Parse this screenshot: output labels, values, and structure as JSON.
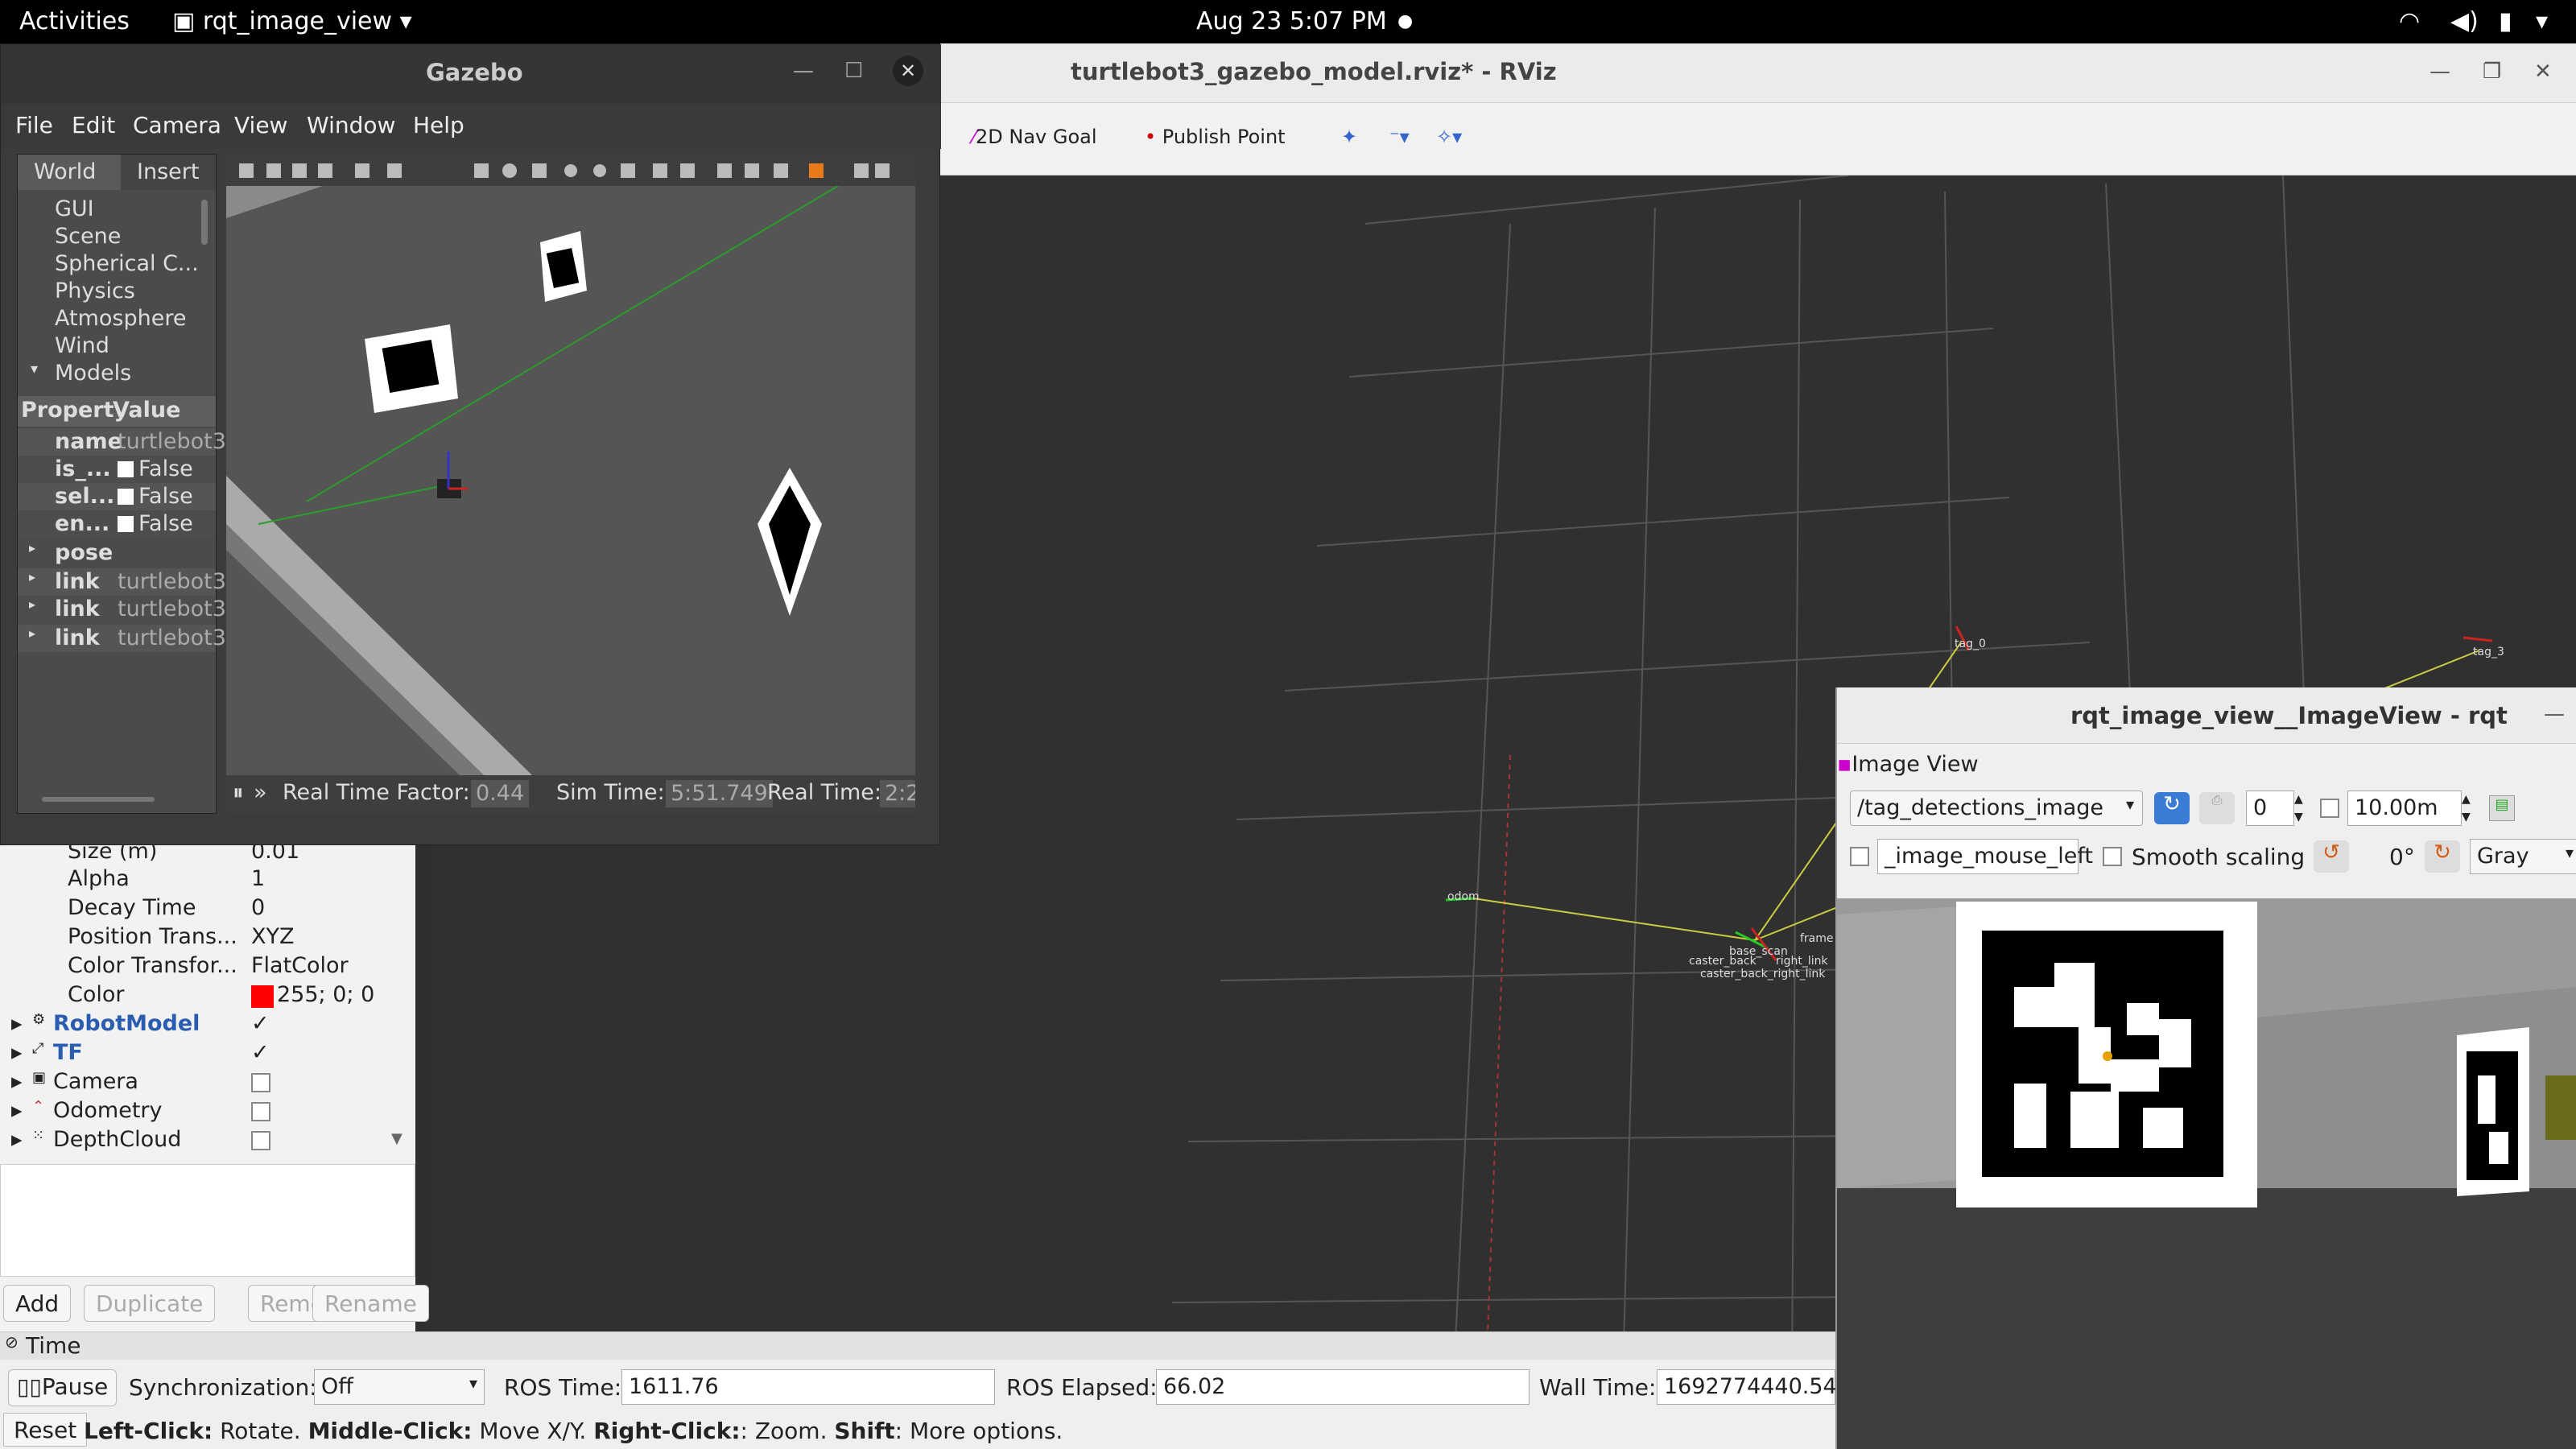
{
  "topbar": {
    "activities": "Activities",
    "app": "rqt_image_view",
    "clock": "Aug 23  5:07 PM"
  },
  "rviz": {
    "title": "turtlebot3_gazebo_model.rviz* - RViz",
    "tools": [
      "2D Nav Goal",
      "Publish Point"
    ],
    "frames": {
      "odom": "odom",
      "tag0": "tag_0",
      "tag3": "tag_3",
      "caster_right": "caster_back_right_link",
      "caster_back": "caster_back",
      "right_link": "right_link",
      "base_scan": "base_scan",
      "frame": "frame"
    },
    "properties": [
      {
        "k": "Size (m)",
        "v": "0.01"
      },
      {
        "k": "Alpha",
        "v": "1"
      },
      {
        "k": "Decay Time",
        "v": "0"
      },
      {
        "k": "Position Trans...",
        "v": "XYZ"
      },
      {
        "k": "Color Transfor...",
        "v": "FlatColor"
      },
      {
        "k": "Color",
        "v": "255; 0; 0"
      }
    ],
    "displays": [
      {
        "k": "RobotModel",
        "v": "✓"
      },
      {
        "k": "TF",
        "v": "✓"
      },
      {
        "k": "Camera",
        "v": ""
      },
      {
        "k": "Odometry",
        "v": ""
      },
      {
        "k": "DepthCloud",
        "v": ""
      }
    ],
    "buttons": {
      "add": "Add",
      "duplicate": "Duplicate",
      "remove": "Remove",
      "rename": "Rename"
    },
    "time": {
      "header": "Time",
      "pause": "Pause",
      "sync_label": "Synchronization:",
      "sync_value": "Off",
      "ros_time_label": "ROS Time:",
      "ros_time": "1611.76",
      "ros_elapsed_label": "ROS Elapsed:",
      "ros_elapsed": "66.02",
      "wall_time_label": "Wall Time:",
      "wall_time": "1692774440.54",
      "reset": "Reset",
      "help_b1": "Left-Click:",
      "help_t1": " Rotate. ",
      "help_b2": "Middle-Click:",
      "help_t2": " Move X/Y. ",
      "help_b3": "Right-Click:",
      "help_t3": ": Zoom. ",
      "help_b4": "Shift",
      "help_t4": ": More options."
    }
  },
  "gazebo": {
    "title": "Gazebo",
    "menu": [
      "File",
      "Edit",
      "Camera",
      "View",
      "Window",
      "Help"
    ],
    "tabs": [
      "World",
      "Insert"
    ],
    "tree": [
      "GUI",
      "Scene",
      "Spherical C...",
      "Physics",
      "Atmosphere",
      "Wind",
      "Models"
    ],
    "prop_header_property": "Property",
    "prop_header_value": "Value",
    "props": [
      {
        "k": "name",
        "v": "turtlebot3"
      },
      {
        "k": "is_...",
        "v": "False"
      },
      {
        "k": "sel...",
        "v": "False"
      },
      {
        "k": "en...",
        "v": "False"
      },
      {
        "k": "pose",
        "v": ""
      },
      {
        "k": "link",
        "v": "turtlebot3"
      },
      {
        "k": "link",
        "v": "turtlebot3"
      },
      {
        "k": "link",
        "v": "turtlebot3"
      }
    ],
    "rtf_label": "Real Time Factor:",
    "rtf": "0.44",
    "sim_label": "Sim Time:",
    "sim": "5:51.749",
    "real_label": "Real Time:",
    "real": "2:2"
  },
  "rqt": {
    "title": "rqt_image_view__ImageView - rqt",
    "section": "Image View",
    "topic": "/tag_detections_image",
    "spin_value": "0",
    "max_value": "10.00m",
    "mouse_topic": "_image_mouse_left",
    "smooth": "Smooth scaling",
    "rotation": "0°",
    "color": "Gray"
  }
}
